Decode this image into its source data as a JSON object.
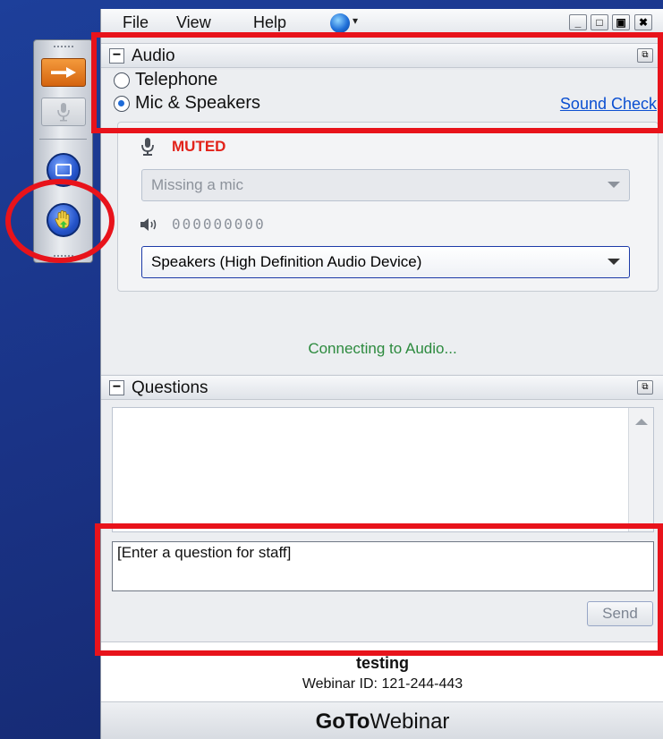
{
  "menu": {
    "file": "File",
    "view": "View",
    "help": "Help"
  },
  "window_controls": {
    "minimize": "_",
    "maximize": "□",
    "restore": "▣",
    "close": "✖"
  },
  "dock": {
    "arrow_icon": "→",
    "mic_icon": "🎙",
    "screen_icon": "▭",
    "hand_icon": "✋"
  },
  "audio": {
    "title": "Audio",
    "collapse": "−",
    "popout": "⧉",
    "telephone_label": "Telephone",
    "mic_speakers_label": "Mic & Speakers",
    "selected_mode": "Mic & Speakers",
    "sound_check_link": "Sound Check",
    "muted_label": "MUTED",
    "mic_icon": "🎙",
    "mic_dropdown_value": "Missing a mic",
    "speaker_icon": "🔈",
    "speaker_level": "000000000",
    "speaker_dropdown_value": "Speakers (High Definition Audio Device)",
    "status": "Connecting to Audio..."
  },
  "questions": {
    "title": "Questions",
    "collapse": "−",
    "popout": "⧉",
    "input_placeholder": "[Enter a question for staff]",
    "send_button": "Send"
  },
  "footer": {
    "webinar_title": "testing",
    "webinar_id": "Webinar ID: 121-244-443",
    "brand_bold": "GoTo",
    "brand_light": "Webinar"
  },
  "colors": {
    "highlight": "#e8131b",
    "muted_red": "#e2231a",
    "status_green": "#2c8a3e",
    "link_blue": "#0b4fd1"
  }
}
